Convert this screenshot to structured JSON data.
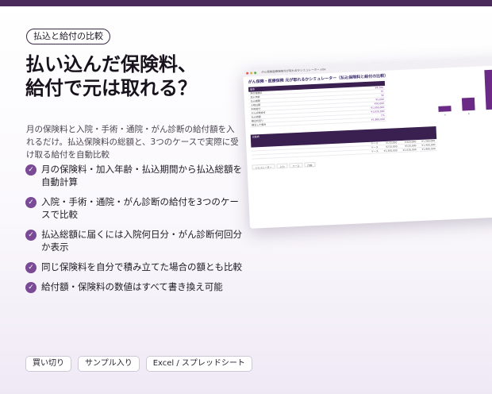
{
  "badge": "払込と給付の比較",
  "headline": [
    "払い込んだ保険料、",
    "給付で元は取れる？"
  ],
  "intro": "月の保険料と入院・手術・通院・がん診断の給付額を入れるだけ。払込保険料の総額と、3つのケースで実際に受け取る給付を自動比較",
  "features": [
    "月の保険料・加入年齢・払込期間から払込総額を自動計算",
    "入院・手術・通院・がん診断の給付を3つのケースで比較",
    "払込総額に届くには入院何日分・がん診断何回分か表示",
    "同じ保険料を自分で積み立てた場合の額とも比較",
    "給付額・保険料の数値はすべて書き換え可能"
  ],
  "tags": [
    "買い切り",
    "サンプル入り",
    "Excel / スプレッドシート"
  ],
  "sheet": {
    "filename": "がん保険医療保険元が取れるかシミュレーター.xlsx",
    "heading": "がん保険・医療保険 元が取れるかシミュレーター（払込保険料と給付の比較）",
    "input_header": "基本",
    "input_rows": [
      {
        "label": "月の保険料",
        "value": "¥4,500"
      },
      {
        "label": "加入年齢",
        "value": "35"
      },
      {
        "label": "払込期間",
        "value": "30"
      },
      {
        "label": "入院日額",
        "value": "¥5,000"
      },
      {
        "label": "手術給付",
        "value": "¥50,000"
      },
      {
        "label": "がん診断給付",
        "value": "¥1,000,000"
      },
      {
        "label": "払込総額",
        "value": "¥1,620,000"
      },
      {
        "label": "積立利回り",
        "value": "1%"
      },
      {
        "label": "積立した場合",
        "value": "¥1,880,000"
      }
    ],
    "chart_ticks": [
      "A",
      "B",
      "C"
    ],
    "case_header": "比較表",
    "case_rows": [
      [
        "ケース",
        "¥170,000",
        "¥420,000",
        "¥1,360,000"
      ],
      [
        "ケース",
        "¥210,000",
        "¥520,000",
        "¥1,400,000"
      ],
      [
        "ケース",
        "¥1,360,000",
        "¥1,620,000",
        "¥1,880,000"
      ]
    ],
    "tabs": [
      "シミュレーター",
      "入力",
      "ケース",
      "比較"
    ]
  },
  "chart_data": {
    "type": "bar",
    "categories": [
      "A",
      "B",
      "C"
    ],
    "values": [
      0.15,
      0.32,
      1.0
    ],
    "title": "",
    "xlabel": "",
    "ylabel": ""
  },
  "colors": {
    "accent": "#7a4a96",
    "dark": "#4a2a5a"
  }
}
